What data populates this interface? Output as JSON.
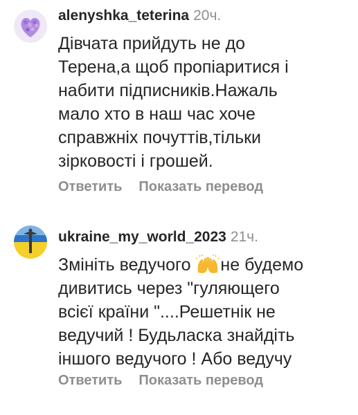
{
  "comments": [
    {
      "username": "alenyshka_teterina",
      "time": "20ч.",
      "text_lines": [
        "Дівчата прийдуть не до",
        "Терена,а щоб пропіаритися і",
        "набити підписників.Нажаль",
        "мало хто в наш час хоче",
        "справжніх почуттів,тільки",
        "зірковості і грошей."
      ],
      "avatar_icon": "lilac-heart-avatar",
      "reply_label": "Ответить",
      "translate_label": "Показать перевод"
    },
    {
      "username": "ukraine_my_world_2023",
      "time": "21ч.",
      "text_line1_before_emoji": "Змініть ведучого ",
      "emoji_icon": "raising-hands-emoji",
      "text_line1_after_emoji": "не будемо",
      "text_lines_rest": [
        "дивитись через \"гуляющего",
        "всієї країни \"....Решетнік не",
        "ведучий ! Будьласка знайдіть",
        "іншого ведучого ! Або ведучу"
      ],
      "avatar_icon": "ukraine-flag-monument-avatar",
      "reply_label": "Ответить",
      "translate_label": "Показать перевод"
    }
  ],
  "colors": {
    "text": "#262626",
    "secondary": "#8e8e8e",
    "lilac": "#b08be0",
    "flag_blue": "#2b74c7",
    "flag_yellow": "#f5d02a"
  }
}
